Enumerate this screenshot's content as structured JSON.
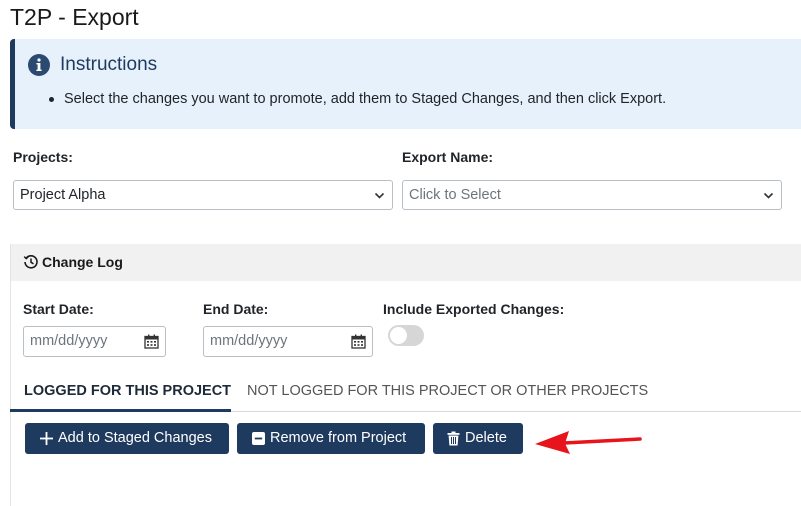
{
  "page": {
    "title": "T2P - Export"
  },
  "instructions": {
    "icon": "info-icon",
    "title": "Instructions",
    "bullet": "Select the changes you want to promote, add them to Staged Changes, and then click Export."
  },
  "projects": {
    "label": "Projects:",
    "value": "Project Alpha"
  },
  "export_name": {
    "label": "Export Name:",
    "placeholder": "Click to Select"
  },
  "change_log": {
    "icon": "history-icon",
    "title": "Change Log",
    "start_date": {
      "label": "Start Date:",
      "placeholder": "mm/dd/yyyy"
    },
    "end_date": {
      "label": "End Date:",
      "placeholder": "mm/dd/yyyy"
    },
    "include_exported": {
      "label": "Include Exported Changes:",
      "checked": false
    }
  },
  "tabs": [
    {
      "label": "LOGGED FOR THIS PROJECT",
      "active": true
    },
    {
      "label": "NOT LOGGED FOR THIS PROJECT OR OTHER PROJECTS",
      "active": false
    }
  ],
  "buttons": {
    "add": {
      "label": "Add to Staged Changes",
      "icon": "plus-icon"
    },
    "remove": {
      "label": "Remove from Project",
      "icon": "minus-square-icon"
    },
    "delete": {
      "label": "Delete",
      "icon": "trash-icon"
    }
  },
  "colors": {
    "primary": "#1f3a5f",
    "info_bg": "#e6f1fb",
    "annotation": "#e8141c"
  }
}
